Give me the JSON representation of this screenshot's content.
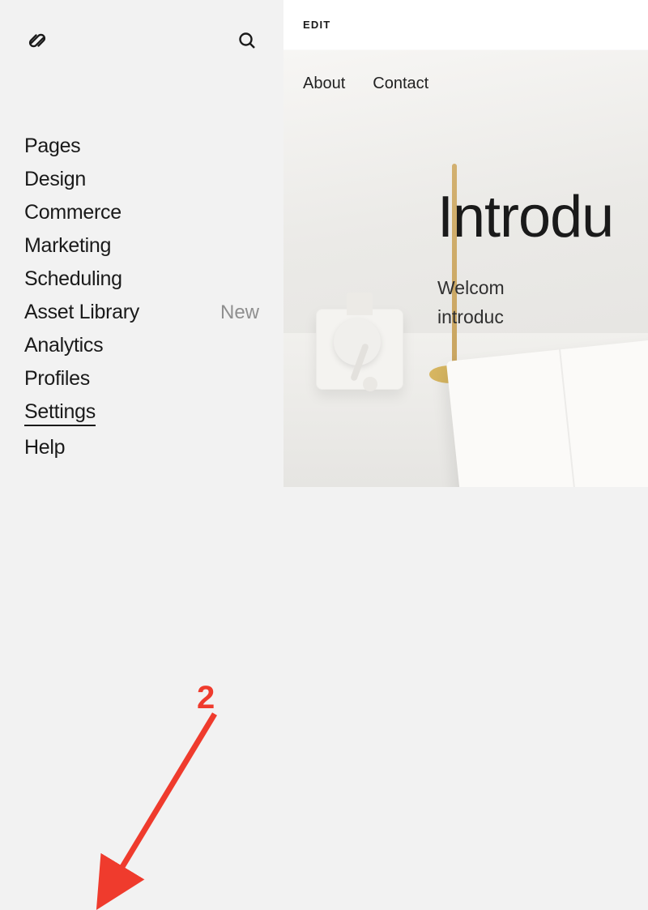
{
  "sidebar": {
    "nav": [
      {
        "label": "Pages",
        "badge": "",
        "active": false
      },
      {
        "label": "Design",
        "badge": "",
        "active": false
      },
      {
        "label": "Commerce",
        "badge": "",
        "active": false
      },
      {
        "label": "Marketing",
        "badge": "",
        "active": false
      },
      {
        "label": "Scheduling",
        "badge": "",
        "active": false
      },
      {
        "label": "Asset Library",
        "badge": "New",
        "active": false
      },
      {
        "label": "Analytics",
        "badge": "",
        "active": false
      },
      {
        "label": "Profiles",
        "badge": "",
        "active": false
      },
      {
        "label": "Settings",
        "badge": "",
        "active": true
      },
      {
        "label": "Help",
        "badge": "",
        "active": false
      }
    ]
  },
  "preview": {
    "edit_label": "EDIT",
    "site_nav": [
      {
        "label": "About"
      },
      {
        "label": "Contact"
      }
    ],
    "hero": {
      "title": "Introdu",
      "line1": "Welcom",
      "line2": "introduc"
    }
  },
  "annotation": {
    "number": "2",
    "color": "#ef3b2d"
  }
}
